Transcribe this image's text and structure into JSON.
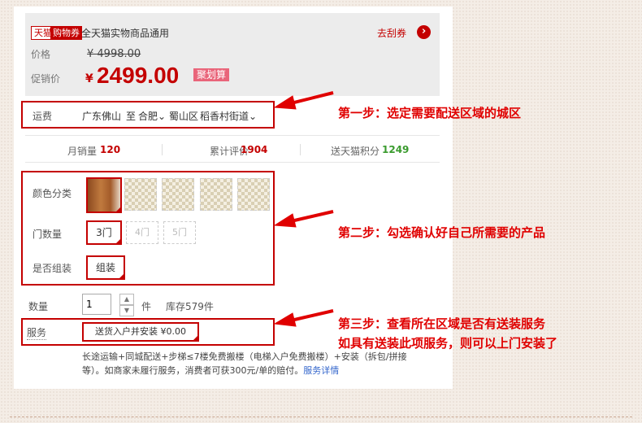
{
  "coupon": {
    "tag1": "天猫",
    "tag2": "购物券",
    "text": "全天猫实物商品通用",
    "link": "去刮券"
  },
  "price": {
    "label_price": "价格",
    "original": "¥ 4998.00",
    "label_promo": "促销价",
    "currency": "¥",
    "promo": "2499.00",
    "badge": "聚划算"
  },
  "shipping": {
    "label": "运费",
    "from": "广东佛山",
    "to_word": "至",
    "city": "合肥",
    "district": "蜀山区",
    "street": "稻香村街道"
  },
  "stats": {
    "monthly_label": "月销量",
    "monthly_value": "120",
    "reviews_label": "累计评价",
    "reviews_value": "1904",
    "points_label": "送天猫积分",
    "points_value": "1249"
  },
  "options": {
    "color_label": "颜色分类",
    "doors_label": "门数量",
    "doors": [
      "3门",
      "4门",
      "5门"
    ],
    "assembly_label": "是否组装",
    "assembly_value": "组装"
  },
  "quantity": {
    "label": "数量",
    "value": "1",
    "unit": "件",
    "stock": "库存579件"
  },
  "service": {
    "label": "服务",
    "option": "送货入户并安装 ¥0.00",
    "desc1": "长途运输+同城配送+步梯≤7楼免费搬楼（电梯入户免费搬楼）+安装（拆包/拼接",
    "desc2": "等）。如商家未履行服务，消费者可获300元/单的赔付。",
    "link": "服务详情"
  },
  "annotations": {
    "step1": "第一步：选定需要配送区域的城区",
    "step2": "第二步：勾选确认好自己所需要的产品",
    "step3a": "第三步：查看所在区域是否有送装服务",
    "step3b": "如具有送装此项服务，则可以上门安装了"
  },
  "colors": {
    "accent": "#c40000",
    "annotation": "#e00000",
    "points": "#3a9b2e"
  }
}
